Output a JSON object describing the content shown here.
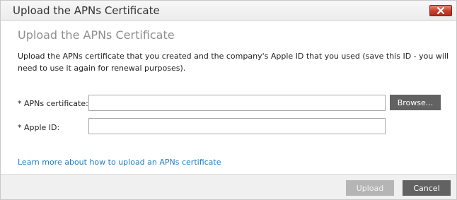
{
  "dialog": {
    "title": "Upload the APNs Certificate",
    "close_icon": "close-icon"
  },
  "content": {
    "heading": "Upload the APNs Certificate",
    "description": "Upload the APNs certificate that you created and the company's Apple ID that you used (save this ID - you will need to use it again for renewal purposes).",
    "certificate_label": "* APNs certificate:",
    "certificate_value": "",
    "browse_label": "Browse...",
    "apple_id_label": "* Apple ID:",
    "apple_id_value": "",
    "help_link": "Learn more about how to upload an APNs certificate"
  },
  "footer": {
    "upload_label": "Upload",
    "upload_enabled": false,
    "cancel_label": "Cancel"
  },
  "colors": {
    "close_button": "#c9422e",
    "dark_button": "#626262",
    "disabled_button": "#b5b5b5",
    "link": "#1e7fc3",
    "heading": "#8e8e8e"
  }
}
